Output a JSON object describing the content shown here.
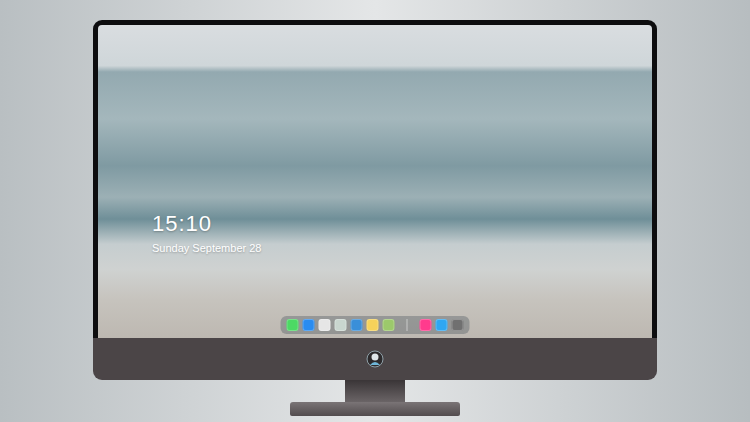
{
  "screen": {
    "clock": {
      "time": "15:10",
      "date": "Sunday September 28"
    },
    "dock": {
      "items": [
        {
          "kind": "app",
          "color": "#4cd964"
        },
        {
          "kind": "app",
          "color": "#2a8cf0"
        },
        {
          "kind": "app",
          "color": "#e6e6e6"
        },
        {
          "kind": "app",
          "color": "#c9d6cf"
        },
        {
          "kind": "app",
          "color": "#3a8fd9"
        },
        {
          "kind": "app",
          "color": "#f6d25a"
        },
        {
          "kind": "app",
          "color": "#9cc96b"
        },
        {
          "kind": "separator"
        },
        {
          "kind": "app",
          "color": "#ff3b8d"
        },
        {
          "kind": "app",
          "color": "#2ea7f2"
        },
        {
          "kind": "app",
          "color": "#707070"
        }
      ]
    }
  }
}
